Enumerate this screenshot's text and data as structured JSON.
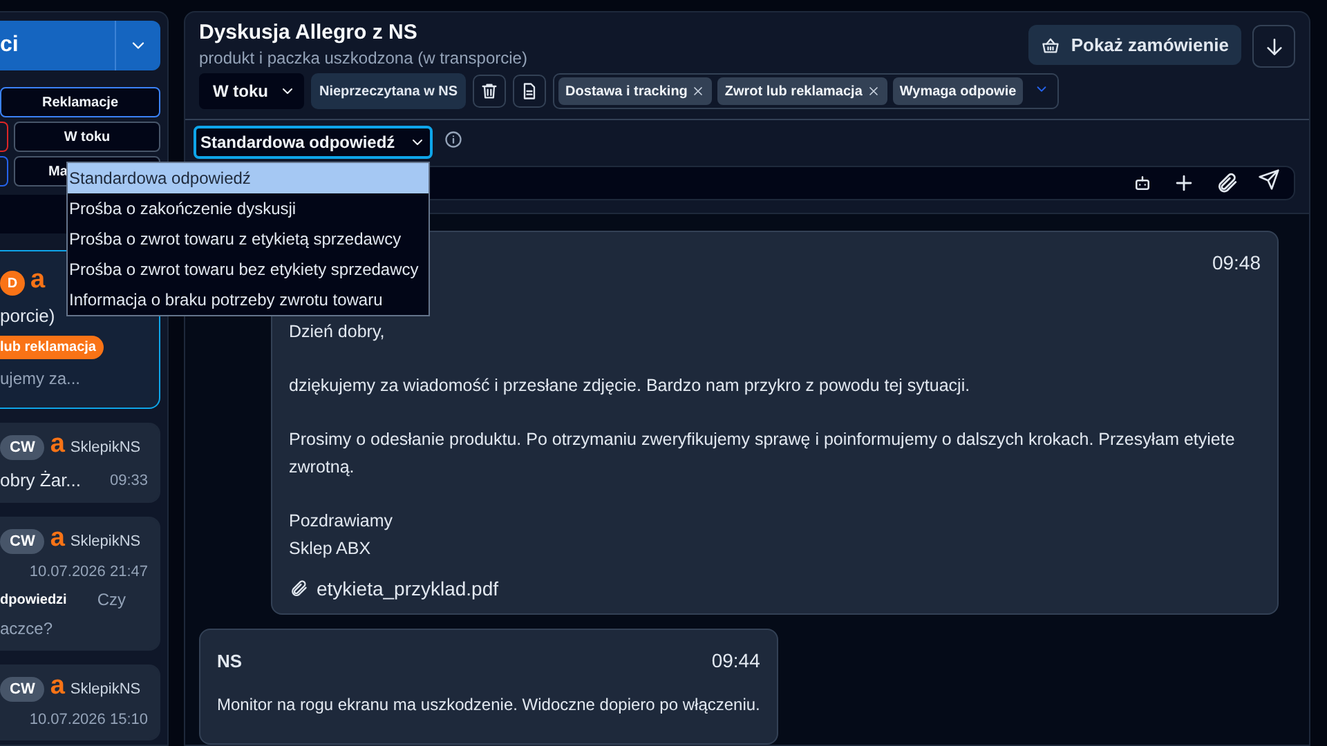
{
  "sidebar": {
    "primary_button": {
      "label": "ci"
    },
    "filter_rows": [
      [
        {
          "kind": "chip",
          "label": "Reklamacje",
          "selected": true
        }
      ],
      [
        {
          "kind": "cut",
          "color": "#dc2626"
        },
        {
          "kind": "chip",
          "label": "W toku",
          "selected": false
        }
      ],
      [
        {
          "kind": "cut",
          "color": "#2563eb"
        },
        {
          "kind": "chip",
          "label": "Ma",
          "selected": false
        }
      ]
    ],
    "conversations": [
      {
        "selected": true,
        "badge": "D",
        "color": "#f97316",
        "mark": "a",
        "title": "porcie)",
        "tag": "lub reklamacja",
        "preview": [
          "ujemy za..."
        ]
      },
      {
        "selected": false,
        "badge": "CW",
        "color": "#475569",
        "mark": "a",
        "shop": "SklepikNS",
        "title": "obry Żar...",
        "time": "09:33"
      },
      {
        "selected": false,
        "badge": "CW",
        "color": "#475569",
        "mark": "a",
        "shop": "SklepikNS",
        "date": "10.07.2026 21:47",
        "status": "dpowiedzi",
        "preview": [
          "Czy",
          "aczce?"
        ]
      },
      {
        "selected": false,
        "badge": "CW",
        "color": "#475569",
        "mark": "a",
        "shop": "SklepikNS",
        "date": "10.07.2026 15:10"
      }
    ]
  },
  "conversation": {
    "title": "Dyskusja Allegro z NS",
    "subtitle": "produkt i paczka uszkodzona (w transporcie)",
    "order_button": "Pokaż zamówienie",
    "status_select": "W toku",
    "unread_chip": "Nieprzeczytana w NS",
    "tags": [
      {
        "label": "Dostawa i tracking",
        "removable": true
      },
      {
        "label": "Zwrot lub reklamacja",
        "removable": true
      },
      {
        "label": "Wymaga odpowie",
        "removable": false
      }
    ]
  },
  "template_select": {
    "value": "Standardowa odpowiedź",
    "open": true,
    "options": [
      {
        "label": "Standardowa odpowiedź",
        "selected": true
      },
      {
        "label": "Prośba o zakończenie dyskusji",
        "selected": false
      },
      {
        "label": "Prośba o zwrot towaru z etykietą sprzedawcy",
        "selected": false
      },
      {
        "label": "Prośba o zwrot towaru bez etykiety sprzedawcy",
        "selected": false
      },
      {
        "label": "Informacja o braku potrzeby zwrotu towaru",
        "selected": false
      }
    ]
  },
  "messages": [
    {
      "outgoing": true,
      "time": "09:48",
      "paragraphs": [
        "Dzień dobry,",
        "dziękujemy za wiadomość i przesłane zdjęcie. Bardzo nam przykro z powodu tej sytuacji.",
        "Prosimy o odesłanie produktu. Po otrzymaniu zweryfikujemy sprawę i poinformujemy o dalszych krokach. Przesyłam etyiete zwrotną.",
        "Pozdrawiamy\nSklep ABX"
      ],
      "attachment": "etykieta_przyklad.pdf"
    },
    {
      "outgoing": false,
      "sender": "NS",
      "time": "09:44",
      "paragraphs": [
        "Monitor na rogu ekranu ma uszkodzenie. Widoczne dopiero po włączeniu."
      ]
    }
  ]
}
